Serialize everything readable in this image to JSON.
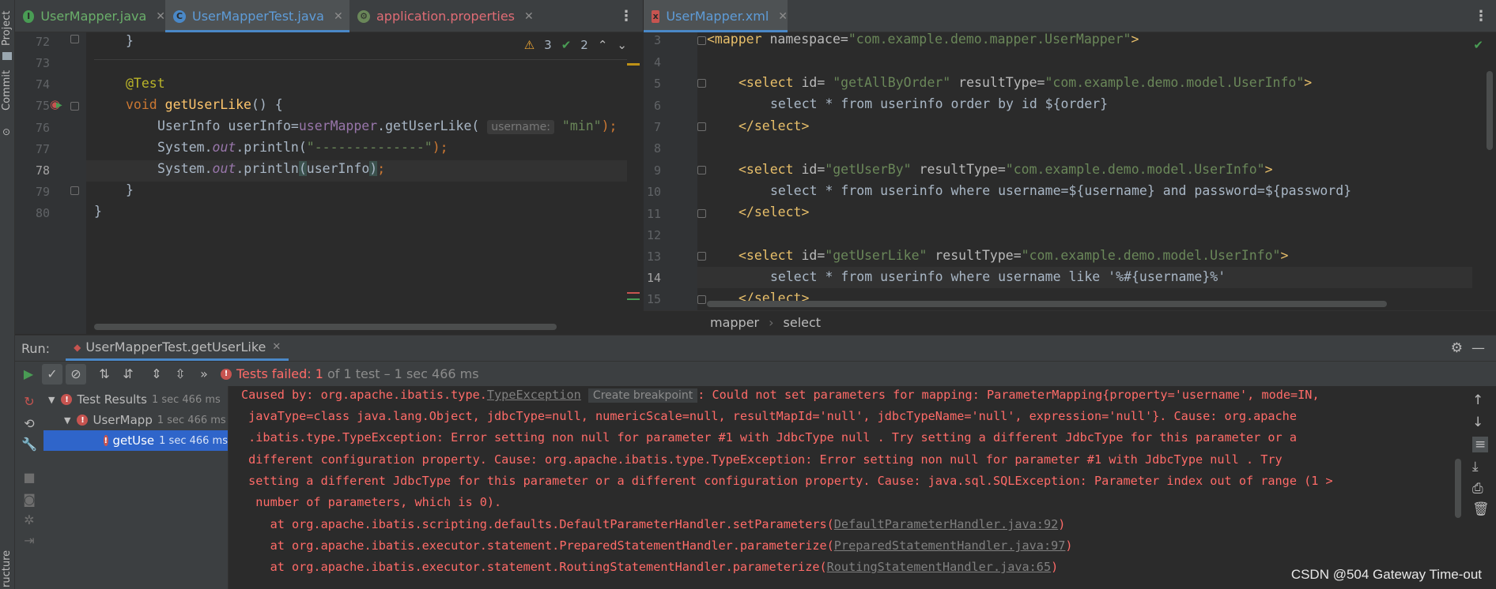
{
  "left_strip": {
    "project_label": "Project",
    "commit_label": "Commit",
    "structure_label": "ructure"
  },
  "left_editor": {
    "tabs": [
      {
        "label": "UserMapper.java",
        "icon": "interface-icon",
        "color": "#499c54"
      },
      {
        "label": "UserMapperTest.java",
        "icon": "class-icon",
        "color": "#4a88c7",
        "active": true
      },
      {
        "label": "application.properties",
        "icon": "properties-icon",
        "color": "#e06c75"
      }
    ],
    "inspections": {
      "warnings": "3",
      "typos": "2"
    },
    "line_numbers": [
      "72",
      "73",
      "74",
      "75",
      "76",
      "77",
      "78",
      "79",
      "80"
    ],
    "current_line": "78",
    "code": {
      "l72": "}",
      "l74_annotation": "@Test",
      "l75_kw": "void ",
      "l75_fn": "getUserLike",
      "l75_rest": "() {",
      "l76_type": "UserInfo ",
      "l76_var": "userInfo",
      "l76_eq": "=",
      "l76_field": "userMapper",
      "l76_dot": ".",
      "l76_method": "getUserLike",
      "l76_open": "(",
      "l76_hint": "username:",
      "l76_arg": "\"min\"",
      "l76_close": ");",
      "l77_sys": "System.",
      "l77_out": "out",
      "l77_print": ".println(",
      "l77_str": "\"--------------\"",
      "l77_close": ");",
      "l78_sys": "System.",
      "l78_out": "out",
      "l78_print": ".println",
      "l78_paren_open": "(",
      "l78_arg": "userInfo",
      "l78_paren_close": ")",
      "l78_semi": ";",
      "l79": "}",
      "l80": "}"
    }
  },
  "right_editor": {
    "tab": {
      "label": "UserMapper.xml",
      "icon": "xml-icon"
    },
    "line_numbers": [
      "3",
      "4",
      "5",
      "6",
      "7",
      "8",
      "9",
      "10",
      "11",
      "12",
      "13",
      "14",
      "15"
    ],
    "current_line": "14",
    "code": {
      "l3_tag": "<mapper ",
      "l3_attr": "namespace=",
      "l3_val": "\"com.example.demo.mapper.UserMapper\"",
      "l3_end": ">",
      "l5_tag": "<select ",
      "l5_attr": "id= ",
      "l5_val": "\"getAllByOrder\"",
      "l5_attr2": " resultType=",
      "l5_val2": "\"com.example.demo.model.UserInfo\"",
      "l5_end": ">",
      "l6": "select * from userinfo order by id ${order}",
      "l7": "</select>",
      "l9_tag": "<select ",
      "l9_attr": "id=",
      "l9_val": "\"getUserBy\"",
      "l9_attr2": " resultType=",
      "l9_val2": "\"com.example.demo.model.UserInfo\"",
      "l9_end": ">",
      "l10": "select * from userinfo where username=${username} and password=${password}",
      "l11": "</select>",
      "l13_tag": "<select ",
      "l13_attr": "id=",
      "l13_val": "\"getUserLike\"",
      "l13_attr2": " resultType=",
      "l13_val2": "\"com.example.demo.model.UserInfo\"",
      "l13_end": ">",
      "l14": "select * from userinfo where username like '%#{username}%'",
      "l15": "</select>"
    },
    "breadcrumb": [
      "mapper",
      "select"
    ]
  },
  "run_panel": {
    "run_label": "Run:",
    "config_tab": "UserMapperTest.getUserLike",
    "status": {
      "failed_label": "Tests failed: 1",
      "rest": " of 1 test – 1 sec 466 ms"
    },
    "tree": [
      {
        "label": "Test Results",
        "time": "1 sec 466 ms"
      },
      {
        "label": "UserMapp",
        "time": "1 sec 466 ms"
      },
      {
        "label": "getUse",
        "time": "1 sec 466 ms",
        "selected": true
      }
    ],
    "console": {
      "line1_pre": "Caused by: org.apache.ibatis.type.",
      "line1_link": "TypeException",
      "line1_chip": "Create breakpoint",
      "line1_post": ": Could not set parameters for mapping: ParameterMapping{property='username', mode=IN,",
      "line2": " javaType=class java.lang.Object, jdbcType=null, numericScale=null, resultMapId='null', jdbcTypeName='null', expression='null'}. Cause: org.apache",
      "line3": " .ibatis.type.TypeException: Error setting non null for parameter #1 with JdbcType null . Try setting a different JdbcType for this parameter or a",
      "line4": " different configuration property. Cause: org.apache.ibatis.type.TypeException: Error setting non null for parameter #1 with JdbcType null . Try",
      "line5": " setting a different JdbcType for this parameter or a different configuration property. Cause: java.sql.SQLException: Parameter index out of range (1 >",
      "line6": "  number of parameters, which is 0).",
      "line7_pre": "    at org.apache.ibatis.scripting.defaults.DefaultParameterHandler.setParameters(",
      "line7_link": "DefaultParameterHandler.java:92",
      "line7_post": ")",
      "line8_pre": "    at org.apache.ibatis.executor.statement.PreparedStatementHandler.parameterize(",
      "line8_link": "PreparedStatementHandler.java:97",
      "line8_post": ")",
      "line9_pre": "    at org.apache.ibatis.executor.statement.RoutingStatementHandler.parameterize(",
      "line9_link": "RoutingStatementHandler.java:65",
      "line9_post": ")"
    }
  },
  "watermark": "CSDN @504 Gateway Time-out"
}
